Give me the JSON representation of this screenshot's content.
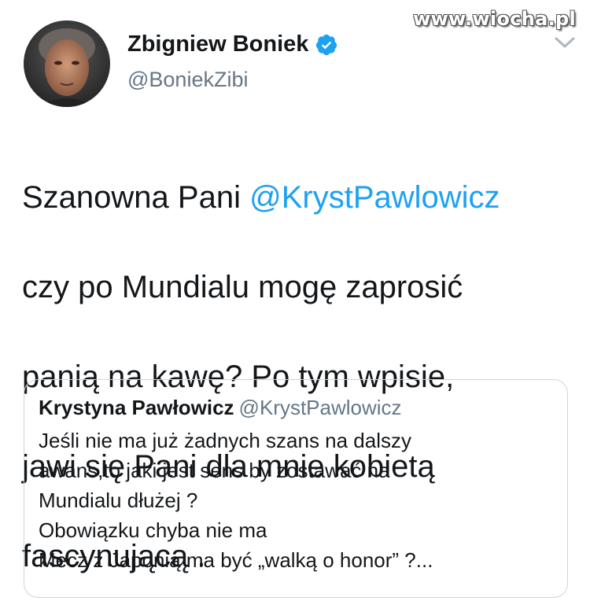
{
  "watermark": "www.wiocha.pl",
  "author": {
    "display_name": "Zbigniew Boniek",
    "handle": "@BoniekZibi",
    "verified": true
  },
  "tweet": {
    "before_mention": "Szanowna Pani ",
    "mention": "@KrystPawlowicz",
    "lines": [
      "czy po Mundialu mogę zaprosić",
      "panią na kawę? Po tym wpisie,",
      "jawi się Pani dla mnie kobietą",
      "fascynującą ."
    ]
  },
  "quoted_tweet": {
    "display_name": "Krystyna Pawłowicz",
    "handle": "@KrystPawlowicz",
    "lines": [
      "Jeśli nie ma już żadnych szans na dalszy",
      "awans,to jaki jest sens by zostawać na",
      "Mundialu dłużej ?",
      "Obowiązku chyba nie ma",
      "Mecz z Japonią ma być „walką o honor” ?..."
    ]
  },
  "icons": {
    "verified": "verified-badge-icon",
    "menu": "chevron-down-icon"
  },
  "colors": {
    "link": "#1da1f2",
    "secondary_text": "#657786",
    "border": "#ccd6dd"
  }
}
